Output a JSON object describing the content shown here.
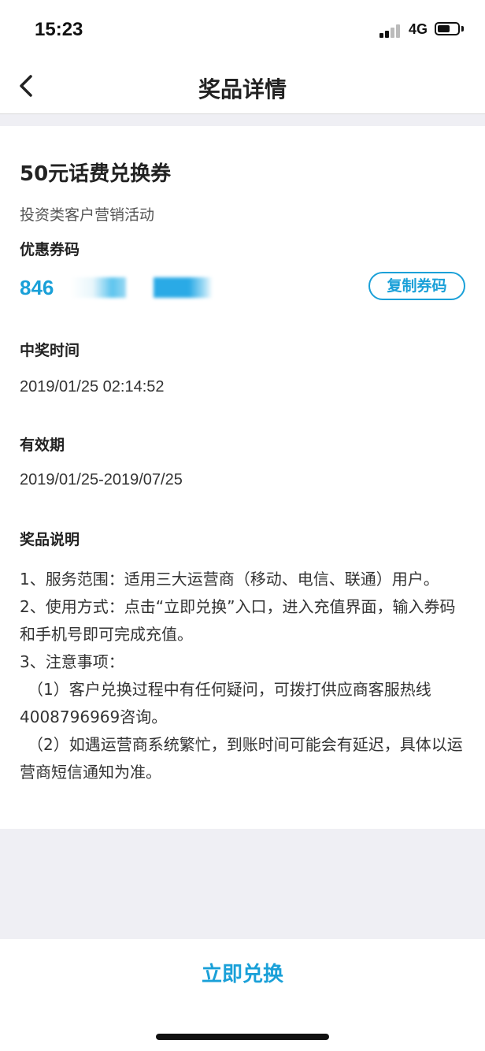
{
  "status_bar": {
    "time": "15:23",
    "network": "4G"
  },
  "nav": {
    "title": "奖品详情"
  },
  "prize": {
    "name": "50元话费兑换券",
    "activity": "投资类客户营销活动",
    "coupon_label": "优惠券码",
    "coupon_code_visible": "846",
    "copy_button": "复制券码",
    "win_time_label": "中奖时间",
    "win_time": "2019/01/25 02:14:52",
    "validity_label": "有效期",
    "validity": "2019/01/25-2019/07/25",
    "description_label": "奖品说明",
    "description": [
      "1、服务范围：适用三大运营商（移动、电信、联通）用户。",
      "2、使用方式：点击“立即兑换”入口，进入充值界面，输入券码和手机号即可完成充值。",
      "3、注意事项：",
      "（1）客户兑换过程中有任何疑问，可拨打供应商客服热线4008796969咨询。",
      "（2）如遇运营商系统繁忙，到账时间可能会有延迟，具体以运营商短信通知为准。"
    ]
  },
  "bottom": {
    "redeem_button": "立即兑换"
  },
  "colors": {
    "accent": "#1aa0d8",
    "background": "#efeff4"
  }
}
